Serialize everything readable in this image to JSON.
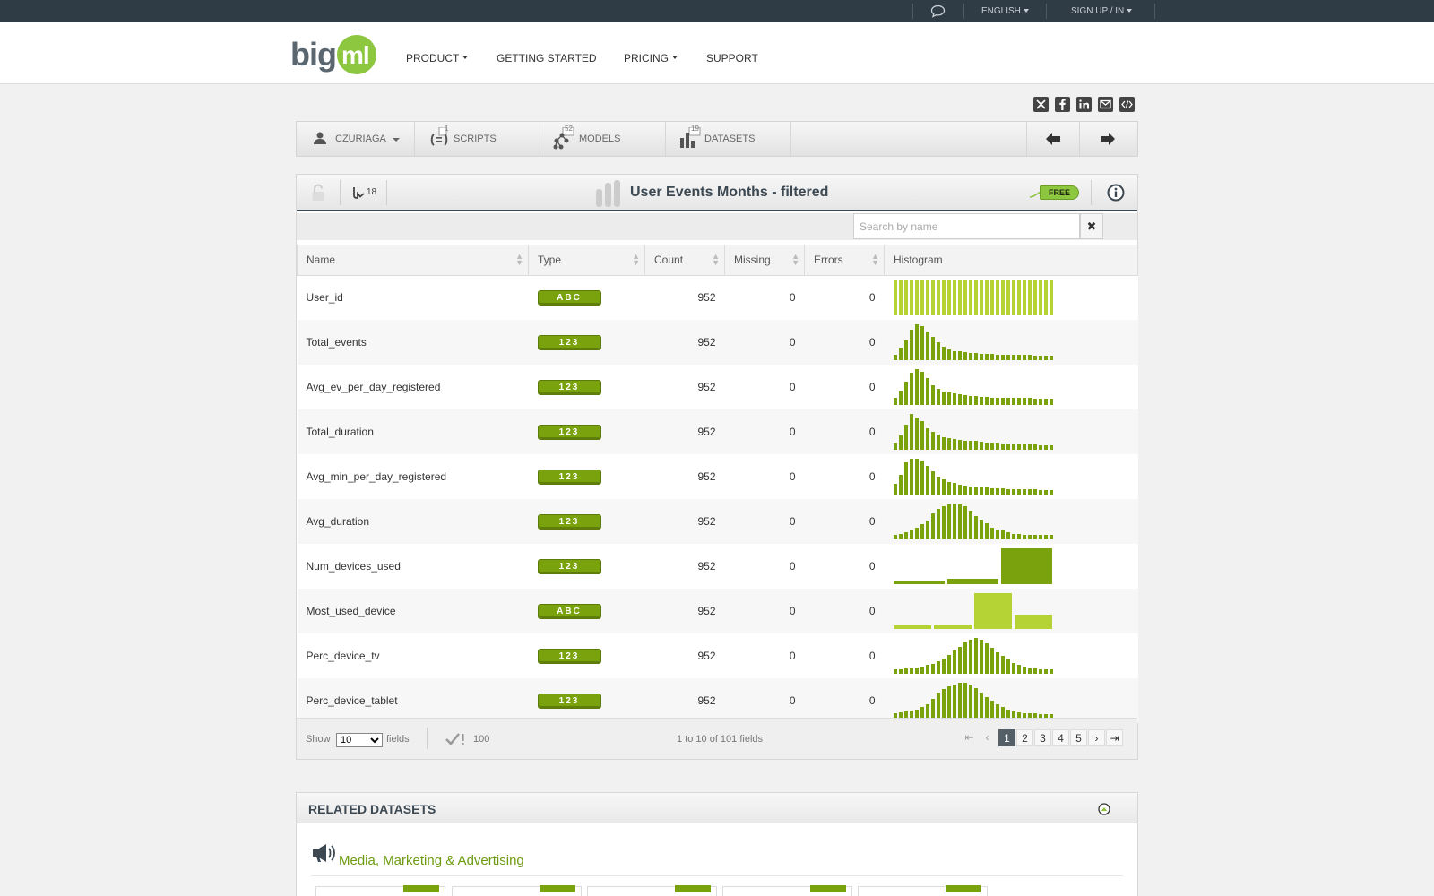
{
  "topbar": {
    "language": "ENGLISH",
    "signup": "SIGN UP / IN"
  },
  "nav": {
    "product": "PRODUCT",
    "getting_started": "GETTING STARTED",
    "pricing": "PRICING",
    "support": "SUPPORT"
  },
  "tabs": {
    "user": "CZURIAGA",
    "scripts": "SCRIPTS",
    "scripts_count": "1",
    "models": "MODELS",
    "models_count": "52",
    "datasets": "DATASETS",
    "datasets_count": "19"
  },
  "dataset": {
    "title": "User Events Months - filtered",
    "clone_count": "18",
    "price_tag": "FREE",
    "search_placeholder": "Search by name"
  },
  "columns": [
    "Name",
    "Type",
    "Count",
    "Missing",
    "Errors",
    "Histogram"
  ],
  "rows": [
    {
      "name": "User_id",
      "type": "ABC",
      "count": "952",
      "missing": "0",
      "errors": "0"
    },
    {
      "name": "Total_events",
      "type": "123",
      "count": "952",
      "missing": "0",
      "errors": "0"
    },
    {
      "name": "Avg_ev_per_day_registered",
      "type": "123",
      "count": "952",
      "missing": "0",
      "errors": "0"
    },
    {
      "name": "Total_duration",
      "type": "123",
      "count": "952",
      "missing": "0",
      "errors": "0"
    },
    {
      "name": "Avg_min_per_day_registered",
      "type": "123",
      "count": "952",
      "missing": "0",
      "errors": "0"
    },
    {
      "name": "Avg_duration",
      "type": "123",
      "count": "952",
      "missing": "0",
      "errors": "0"
    },
    {
      "name": "Num_devices_used",
      "type": "123",
      "count": "952",
      "missing": "0",
      "errors": "0"
    },
    {
      "name": "Most_used_device",
      "type": "ABC",
      "count": "952",
      "missing": "0",
      "errors": "0"
    },
    {
      "name": "Perc_device_tv",
      "type": "123",
      "count": "952",
      "missing": "0",
      "errors": "0"
    },
    {
      "name": "Perc_device_tablet",
      "type": "123",
      "count": "952",
      "missing": "0",
      "errors": "0"
    }
  ],
  "histograms": [
    {
      "color": "#b5d334",
      "bins": [
        1,
        1,
        1,
        1,
        1,
        1,
        1,
        1,
        1,
        1,
        1,
        1,
        1,
        1,
        1,
        1,
        1,
        1,
        1,
        1,
        1,
        1,
        1,
        1,
        1,
        1,
        1,
        1,
        1,
        1
      ]
    },
    {
      "color": "#7aa20d",
      "bins": [
        0.15,
        0.35,
        0.55,
        0.85,
        1.0,
        0.95,
        0.8,
        0.65,
        0.5,
        0.38,
        0.3,
        0.26,
        0.24,
        0.22,
        0.2,
        0.19,
        0.18,
        0.17,
        0.17,
        0.16,
        0.16,
        0.15,
        0.15,
        0.14,
        0.14,
        0.14,
        0.13,
        0.13,
        0.13,
        0.13
      ]
    },
    {
      "color": "#7aa20d",
      "bins": [
        0.2,
        0.4,
        0.65,
        0.9,
        1.0,
        0.92,
        0.75,
        0.55,
        0.45,
        0.38,
        0.34,
        0.32,
        0.3,
        0.28,
        0.26,
        0.24,
        0.23,
        0.22,
        0.21,
        0.21,
        0.2,
        0.2,
        0.2,
        0.19,
        0.19,
        0.19,
        0.18,
        0.18,
        0.18,
        0.18
      ]
    },
    {
      "color": "#7aa20d",
      "bins": [
        0.2,
        0.4,
        0.7,
        1.0,
        0.9,
        0.8,
        0.6,
        0.5,
        0.42,
        0.36,
        0.32,
        0.3,
        0.28,
        0.26,
        0.25,
        0.24,
        0.22,
        0.21,
        0.2,
        0.19,
        0.18,
        0.17,
        0.16,
        0.15,
        0.15,
        0.14,
        0.14,
        0.13,
        0.13,
        0.13
      ]
    },
    {
      "color": "#7aa20d",
      "bins": [
        0.3,
        0.55,
        0.9,
        1.0,
        1.0,
        0.95,
        0.8,
        0.65,
        0.5,
        0.42,
        0.36,
        0.32,
        0.28,
        0.25,
        0.23,
        0.21,
        0.2,
        0.19,
        0.18,
        0.18,
        0.17,
        0.16,
        0.16,
        0.15,
        0.15,
        0.14,
        0.14,
        0.13,
        0.13,
        0.13
      ]
    },
    {
      "color": "#7aa20d",
      "bins": [
        0.12,
        0.16,
        0.2,
        0.26,
        0.32,
        0.42,
        0.52,
        0.72,
        0.85,
        0.92,
        0.98,
        1.0,
        0.98,
        0.92,
        0.8,
        0.65,
        0.55,
        0.45,
        0.32,
        0.28,
        0.25,
        0.2,
        0.16,
        0.14,
        0.13,
        0.13,
        0.12,
        0.12,
        0.12,
        0.12
      ]
    },
    {
      "color": "#7aa20d",
      "bins": [
        0.1,
        0.15,
        1.0
      ]
    },
    {
      "color": "#b5d334",
      "bins": [
        0.1,
        0.1,
        1.0,
        0.4
      ]
    },
    {
      "color": "#7aa20d",
      "bins": [
        0.12,
        0.12,
        0.14,
        0.16,
        0.18,
        0.2,
        0.24,
        0.28,
        0.34,
        0.42,
        0.52,
        0.65,
        0.76,
        0.88,
        0.96,
        1.0,
        0.94,
        0.84,
        0.72,
        0.6,
        0.5,
        0.4,
        0.3,
        0.24,
        0.2,
        0.16,
        0.14,
        0.12,
        0.12,
        0.12
      ]
    },
    {
      "color": "#7aa20d",
      "bins": [
        0.15,
        0.18,
        0.2,
        0.22,
        0.26,
        0.32,
        0.4,
        0.55,
        0.72,
        0.82,
        0.9,
        0.96,
        1.0,
        1.0,
        0.94,
        0.85,
        0.72,
        0.6,
        0.5,
        0.4,
        0.32,
        0.26,
        0.2,
        0.18,
        0.16,
        0.15,
        0.14,
        0.13,
        0.12,
        0.12
      ]
    }
  ],
  "footer": {
    "show_label": "Show",
    "show_value": "10",
    "fields_label": "fields",
    "preview_count": "100",
    "range_text": "1 to 10 of 101 fields",
    "pages": [
      "1",
      "2",
      "3",
      "4",
      "5"
    ]
  },
  "related": {
    "title": "RELATED DATASETS",
    "category": "Media, Marketing & Advertising"
  },
  "colors": {
    "brand_green": "#8dc63f",
    "type_badge": "#7aa20d",
    "dark": "#3c4852"
  }
}
